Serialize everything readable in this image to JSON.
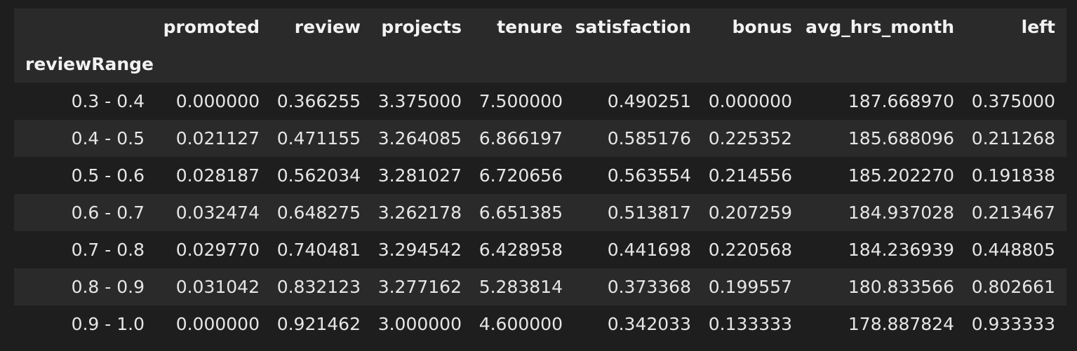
{
  "table": {
    "index_name": "reviewRange",
    "columns": [
      "promoted",
      "review",
      "projects",
      "tenure",
      "satisfaction",
      "bonus",
      "avg_hrs_month",
      "left"
    ],
    "rows": [
      {
        "index": "0.3 - 0.4",
        "values": [
          "0.000000",
          "0.366255",
          "3.375000",
          "7.500000",
          "0.490251",
          "0.000000",
          "187.668970",
          "0.375000"
        ]
      },
      {
        "index": "0.4 - 0.5",
        "values": [
          "0.021127",
          "0.471155",
          "3.264085",
          "6.866197",
          "0.585176",
          "0.225352",
          "185.688096",
          "0.211268"
        ]
      },
      {
        "index": "0.5 - 0.6",
        "values": [
          "0.028187",
          "0.562034",
          "3.281027",
          "6.720656",
          "0.563554",
          "0.214556",
          "185.202270",
          "0.191838"
        ]
      },
      {
        "index": "0.6 - 0.7",
        "values": [
          "0.032474",
          "0.648275",
          "3.262178",
          "6.651385",
          "0.513817",
          "0.207259",
          "184.937028",
          "0.213467"
        ]
      },
      {
        "index": "0.7 - 0.8",
        "values": [
          "0.029770",
          "0.740481",
          "3.294542",
          "6.428958",
          "0.441698",
          "0.220568",
          "184.236939",
          "0.448805"
        ]
      },
      {
        "index": "0.8 - 0.9",
        "values": [
          "0.031042",
          "0.832123",
          "3.277162",
          "5.283814",
          "0.373368",
          "0.199557",
          "180.833566",
          "0.802661"
        ]
      },
      {
        "index": "0.9 - 1.0",
        "values": [
          "0.000000",
          "0.921462",
          "3.000000",
          "4.600000",
          "0.342033",
          "0.133333",
          "178.887824",
          "0.933333"
        ]
      }
    ]
  }
}
